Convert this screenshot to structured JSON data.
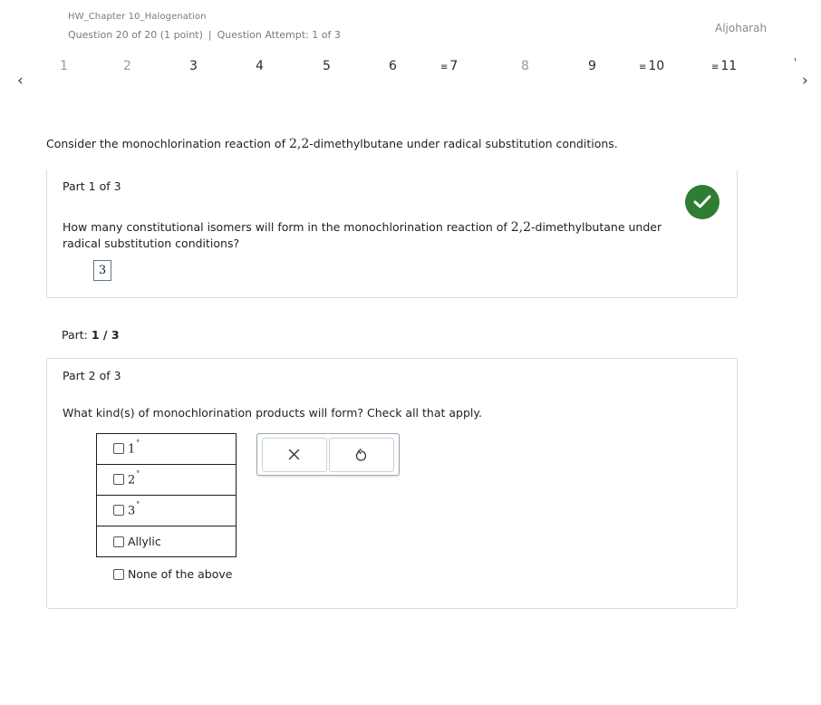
{
  "header": {
    "assignment_title": "HW_Chapter 10_Halogenation",
    "question_position": "Question 20 of 20 (1 point)",
    "separator": "|",
    "attempt": "Question Attempt: 1 of 3",
    "user_name": "Aljoharah"
  },
  "question_nav": [
    {
      "label": "1",
      "dim": true,
      "lines": false
    },
    {
      "label": "2",
      "dim": true,
      "lines": false
    },
    {
      "label": "3",
      "dim": false,
      "lines": false
    },
    {
      "label": "4",
      "dim": false,
      "lines": false
    },
    {
      "label": "5",
      "dim": false,
      "lines": false
    },
    {
      "label": "6",
      "dim": false,
      "lines": false
    },
    {
      "label": "7",
      "dim": false,
      "lines": true
    },
    {
      "label": "8",
      "dim": true,
      "lines": false
    },
    {
      "label": "9",
      "dim": false,
      "lines": false
    },
    {
      "label": "10",
      "dim": false,
      "lines": true
    },
    {
      "label": "11",
      "dim": false,
      "lines": true
    }
  ],
  "nav_icons": {
    "prev": "chevron-left-icon",
    "next": "chevron-right-icon",
    "lines": "flag-lines-icon"
  },
  "intro": {
    "before": "Consider the monochlorination reaction of ",
    "molecule": "2,2",
    "after": "-dimethylbutane under radical substitution conditions."
  },
  "part1": {
    "title": "Part 1 of 3",
    "question_before": "How many constitutional isomers will form in the monochlorination reaction of ",
    "question_molecule": "2,2",
    "question_after": "-dimethylbutane under radical substitution conditions?",
    "answer": "3",
    "status_icon": "check-circle-icon",
    "status_color": "#2e7d32"
  },
  "part_progress": {
    "label": "Part:",
    "value": "1 / 3"
  },
  "part2": {
    "title": "Part 2 of 3",
    "question": "What kind(s) of monochlorination products will form? Check all that apply.",
    "options": [
      {
        "label": "1",
        "degree": "°"
      },
      {
        "label": "2",
        "degree": "°"
      },
      {
        "label": "3",
        "degree": "°"
      },
      {
        "label": "Allylic",
        "degree": ""
      }
    ],
    "none_option": "None of the above",
    "tools": {
      "clear_icon": "close-icon",
      "undo_icon": "undo-icon"
    }
  }
}
